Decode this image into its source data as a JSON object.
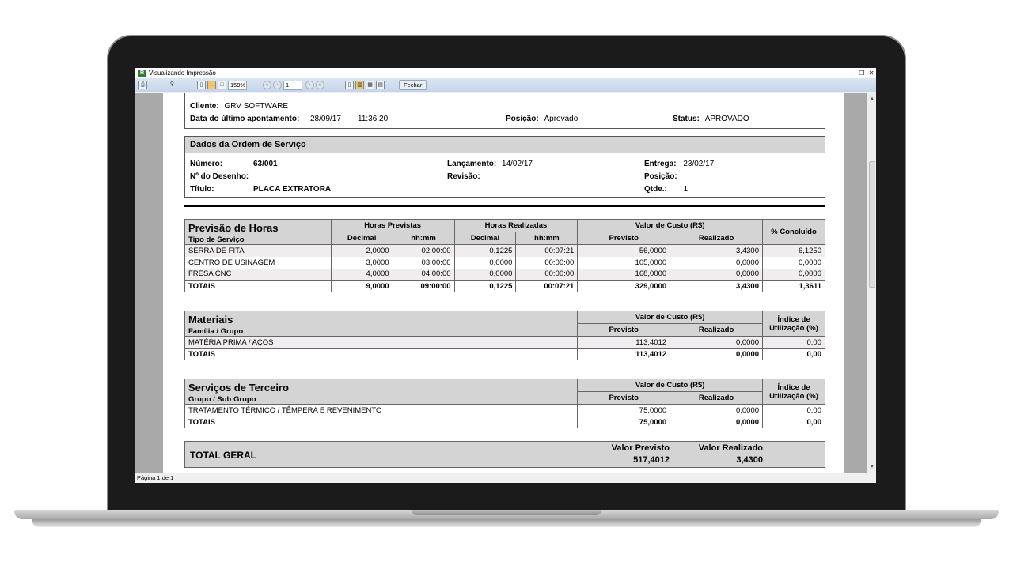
{
  "window": {
    "title": "Visualizando Impressão",
    "zoom": "159%",
    "page_input": "1",
    "close_button": "Fechar",
    "status": "Página 1 de 1"
  },
  "header": {
    "cliente_label": "Cliente:",
    "cliente": "GRV SOFTWARE",
    "ultimo_label": "Data do último apontamento:",
    "ultimo_data": "28/09/17",
    "ultimo_hora": "11:36:20",
    "posicao_label": "Posição:",
    "posicao": "Aprovado",
    "status_label": "Status:",
    "status": "APROVADO"
  },
  "ordem": {
    "title": "Dados da Ordem de Serviço",
    "numero_label": "Número:",
    "numero": "63/001",
    "lancamento_label": "Lançamento:",
    "lancamento": "14/02/17",
    "entrega_label": "Entrega:",
    "entrega": "23/02/17",
    "desenho_label": "Nº do Desenho:",
    "revisao_label": "Revisão:",
    "posicao_label": "Posição:",
    "titulo_label": "Título:",
    "titulo": "PLACA EXTRATORA",
    "qtde_label": "Qtde.:",
    "qtde": "1"
  },
  "horas": {
    "title": "Previsão de Horas",
    "subtitle": "Tipo de Serviço",
    "h_prev": "Horas Previstas",
    "h_real": "Horas Realizadas",
    "h_custo": "Valor de Custo (R$)",
    "h_concl": "% Concluído",
    "decimal": "Decimal",
    "hhmm": "hh:mm",
    "previsto": "Previsto",
    "realizado": "Realizado",
    "rows": [
      {
        "tipo": "SERRA DE FITA",
        "pd": "2,0000",
        "ph": "02:00:00",
        "rd": "0,1225",
        "rh": "00:07:21",
        "cp": "56,0000",
        "cr": "3,4300",
        "pc": "6,1250"
      },
      {
        "tipo": "CENTRO DE USINAGEM",
        "pd": "3,0000",
        "ph": "03:00:00",
        "rd": "0,0000",
        "rh": "00:00:00",
        "cp": "105,0000",
        "cr": "0,0000",
        "pc": "0,0000"
      },
      {
        "tipo": "FRESA CNC",
        "pd": "4,0000",
        "ph": "04:00:00",
        "rd": "0,0000",
        "rh": "00:00:00",
        "cp": "168,0000",
        "cr": "0,0000",
        "pc": "0,0000"
      }
    ],
    "totals": {
      "label": "TOTAIS",
      "pd": "9,0000",
      "ph": "09:00:00",
      "rd": "0,1225",
      "rh": "00:07:21",
      "cp": "329,0000",
      "cr": "3,4300",
      "pc": "1,3611"
    }
  },
  "materiais": {
    "title": "Materiais",
    "subtitle": "Família / Grupo",
    "h_custo": "Valor de Custo (R$)",
    "h_indice1": "Índice de",
    "h_indice2": "Utilização (%)",
    "previsto": "Previsto",
    "realizado": "Realizado",
    "row": {
      "nome": "MATÉRIA PRIMA / AÇOS",
      "p": "113,4012",
      "r": "0,0000",
      "i": "0,00"
    },
    "totals": {
      "label": "TOTAIS",
      "p": "113,4012",
      "r": "0,0000",
      "i": "0,00"
    }
  },
  "terceiros": {
    "title": "Serviços de Terceiro",
    "subtitle": "Grupo / Sub Grupo",
    "h_custo": "Valor de Custo (R$)",
    "h_indice1": "Índice de",
    "h_indice2": "Utilização (%)",
    "previsto": "Previsto",
    "realizado": "Realizado",
    "row": {
      "nome": "TRATAMENTO TÉRMICO / TÊMPERA E REVENIMENTO",
      "p": "75,0000",
      "r": "0,0000",
      "i": "0,00"
    },
    "totals": {
      "label": "TOTAIS",
      "p": "75,0000",
      "r": "0,0000",
      "i": "0,00"
    }
  },
  "total_geral": {
    "label": "TOTAL GERAL",
    "prev_label": "Valor Previsto",
    "prev": "517,4012",
    "real_label": "Valor Realizado",
    "real": "3,4300"
  }
}
